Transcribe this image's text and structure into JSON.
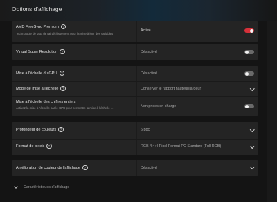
{
  "page": {
    "title": "Options d'affichage"
  },
  "help_glyph": "?",
  "colors": {
    "accent": "#d6313a",
    "toggle_off": "#6a6a6a"
  },
  "settings": [
    {
      "label": "AMD FreeSync Premium",
      "sublabel": "Technologie de taux de rafraîchissement pour la mise à jour des variables",
      "value": "Activé",
      "control": "toggle",
      "on": true
    },
    {
      "label": "Virtual Super Resolution",
      "value": "Désactivé",
      "control": "toggle",
      "on": false
    },
    {
      "label": "Mise à l'échelle du GPU",
      "value": "Désactivé",
      "control": "toggle",
      "on": false
    },
    {
      "label": "Mode de mise à l'échelle",
      "value": "Conserver le rapport hauteur/largeur",
      "control": "dropdown"
    },
    {
      "label": "Mise à l'échelle des chiffres entiers",
      "sublabel": "Activez la mise à l'échelle par le GPU pour permettre la mise à l'échelle ...",
      "value": "Non prises en charge",
      "control": "toggle",
      "on": false
    },
    {
      "label": "Profondeur de couleurs",
      "value": "6 bpc",
      "control": "dropdown"
    },
    {
      "label": "Format de pixels",
      "value": "RGB 4:4:4 Pixel Format PC Standard (Full RGB)",
      "control": "dropdown"
    },
    {
      "label": "Amélioration de couleur de l'affichage",
      "value": "Désactivé",
      "control": "dropdown"
    }
  ],
  "footer": {
    "label": "Caractéristiques d'affichage"
  }
}
